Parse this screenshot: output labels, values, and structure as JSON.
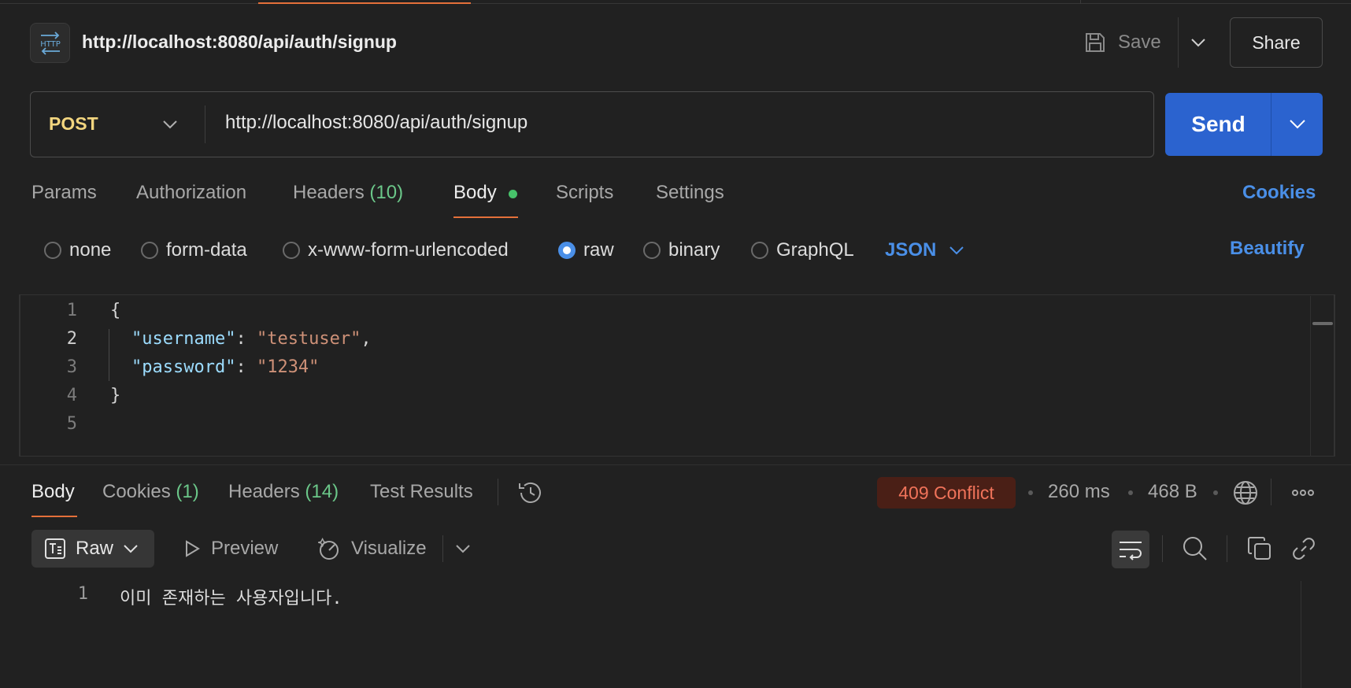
{
  "header": {
    "icon_text": "HTTP",
    "title": "http://localhost:8080/api/auth/signup",
    "save_label": "Save",
    "share_label": "Share"
  },
  "request": {
    "method": "POST",
    "url": "http://localhost:8080/api/auth/signup",
    "send_label": "Send"
  },
  "request_tabs": [
    {
      "label": "Params",
      "count": ""
    },
    {
      "label": "Authorization",
      "count": ""
    },
    {
      "label": "Headers",
      "count": "(10)"
    },
    {
      "label": "Body",
      "count": "",
      "active": true
    },
    {
      "label": "Scripts",
      "count": ""
    },
    {
      "label": "Settings",
      "count": ""
    }
  ],
  "cookies_label": "Cookies",
  "body_types": [
    {
      "label": "none",
      "checked": false
    },
    {
      "label": "form-data",
      "checked": false
    },
    {
      "label": "x-www-form-urlencoded",
      "checked": false
    },
    {
      "label": "raw",
      "checked": true
    },
    {
      "label": "binary",
      "checked": false
    },
    {
      "label": "GraphQL",
      "checked": false
    }
  ],
  "body_format": "JSON",
  "beautify_label": "Beautify",
  "editor": {
    "line_numbers": [
      "1",
      "2",
      "3",
      "4",
      "5"
    ],
    "open_brace": "{",
    "close_brace": "}",
    "fields": [
      {
        "key": "\"username\"",
        "value": "\"testuser\"",
        "trailing": ","
      },
      {
        "key": "\"password\"",
        "value": "\"1234\"",
        "trailing": ""
      }
    ],
    "colon": ": "
  },
  "response_tabs": [
    {
      "label": "Body",
      "count": "",
      "active": true
    },
    {
      "label": "Cookies",
      "count": "(1)"
    },
    {
      "label": "Headers",
      "count": "(14)"
    },
    {
      "label": "Test Results",
      "count": ""
    }
  ],
  "response_meta": {
    "status": "409 Conflict",
    "time": "260 ms",
    "size": "468 B"
  },
  "response_toolbar": {
    "raw_label": "Raw",
    "preview_label": "Preview",
    "visualize_label": "Visualize"
  },
  "response_body": {
    "line_number": "1",
    "text": "이미 존재하는 사용자입니다."
  },
  "colors": {
    "accent_orange": "#e4703a",
    "send_blue": "#2b63cf",
    "link_blue": "#4a8fe7",
    "method_yellow": "#f2d57f",
    "status_red": "#f0735a",
    "count_green": "#6bc789"
  }
}
